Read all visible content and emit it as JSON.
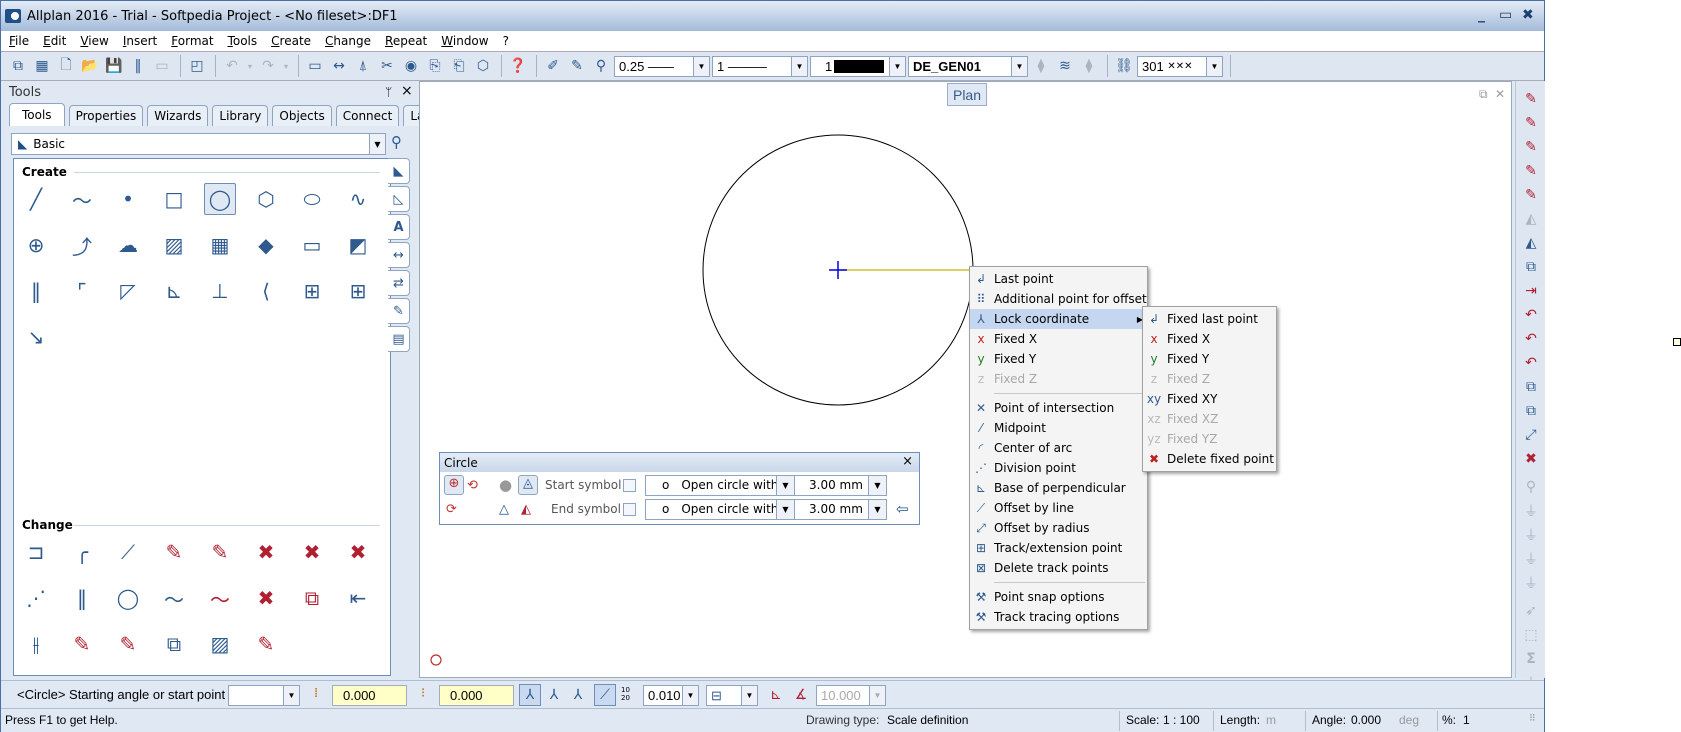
{
  "window": {
    "title": "Allplan 2016 - Trial - Softpedia Project - <No fileset>:DF1",
    "controls": {
      "minimize": "_",
      "maximize": "▭",
      "close": "✖"
    }
  },
  "menubar": [
    "File",
    "Edit",
    "View",
    "Insert",
    "Format",
    "Tools",
    "Create",
    "Change",
    "Repeat",
    "Window",
    "?"
  ],
  "toolbar": {
    "pen_thickness": "0.25 ——",
    "line_type": "1 ———",
    "color": "1",
    "color_swatch": "#000000",
    "layer": "DE_GEN01",
    "pattern_value": "301",
    "pattern_glyph": "✕✕✕"
  },
  "tools_panel": {
    "title": "Tools",
    "pin": "📌",
    "close": "×",
    "tabs": [
      "Tools",
      "Properties",
      "Wizards",
      "Library",
      "Objects",
      "Connect",
      "Layers"
    ],
    "active_tab": "Tools",
    "family": "Basic",
    "sections": {
      "create": "Create",
      "change": "Change"
    },
    "create_icons": [
      "line-icon",
      "polyline-icon",
      "point-icon",
      "rectangle-icon",
      "circle-icon",
      "polygon-icon",
      "ellipse-icon",
      "spline-icon",
      "cross-circle-icon",
      "offset-icon",
      "cloud-icon",
      "hatching-icon",
      "pattern-icon",
      "fill-icon",
      "bitmap-icon",
      "style-area-icon",
      "parallel-lines-icon",
      "parallel-offset-icon",
      "surface-icon",
      "angle-icon",
      "perpendicular-icon",
      "tangent-icon",
      "grid-copy-icon",
      "matrix-copy-icon",
      "point-to-line-icon"
    ],
    "change_icons": [
      "join-lines-icon",
      "fillet-icon",
      "chamfer-icon",
      "modify-lines-icon",
      "modify-area-icon",
      "delete-segment-icon",
      "delete-between-icon",
      "delete-point-icon",
      "divide-icon",
      "parallel-edit-icon",
      "parallel-circle-icon",
      "polyline-edit-icon",
      "polyline-delete-icon",
      "split-icon",
      "delete-overlap-icon",
      "align-icon",
      "mid-align-icon",
      "edit-copy-icon",
      "edit-transform-icon",
      "group-icon",
      "hatch-edit-icon",
      "pattern-edit-icon"
    ]
  },
  "view": {
    "label": "Plan"
  },
  "context_menu": {
    "items": [
      {
        "label": "Last point",
        "icon": "↲",
        "disabled": false
      },
      {
        "label": "Additional point for offset",
        "icon": "⠿",
        "disabled": false
      },
      {
        "label": "Lock coordinate",
        "icon": "⅄",
        "disabled": false,
        "highlighted": true,
        "submenu": true
      },
      {
        "label": "Fixed X",
        "icon": "x",
        "disabled": false
      },
      {
        "label": "Fixed Y",
        "icon": "y",
        "disabled": false
      },
      {
        "label": "Fixed Z",
        "icon": "z",
        "disabled": true
      },
      {
        "separator": true
      },
      {
        "label": "Point of intersection",
        "icon": "✕",
        "disabled": false
      },
      {
        "label": "Midpoint",
        "icon": "⁄",
        "disabled": false
      },
      {
        "label": "Center of arc",
        "icon": "◜",
        "disabled": false
      },
      {
        "label": "Division point",
        "icon": "⋰",
        "disabled": false
      },
      {
        "label": "Base of perpendicular",
        "icon": "⊾",
        "disabled": false
      },
      {
        "label": "Offset by line",
        "icon": "⟋",
        "disabled": false
      },
      {
        "label": "Offset by radius",
        "icon": "⤢",
        "disabled": false
      },
      {
        "label": "Track/extension point",
        "icon": "⊞",
        "disabled": false
      },
      {
        "label": "Delete track points",
        "icon": "⊠",
        "disabled": false
      },
      {
        "separator": true
      },
      {
        "label": "Point snap options",
        "icon": "⚒",
        "disabled": false
      },
      {
        "label": "Track tracing options",
        "icon": "⚒",
        "disabled": false
      }
    ]
  },
  "submenu": {
    "items": [
      {
        "label": "Fixed last point",
        "icon": "↲",
        "disabled": false
      },
      {
        "label": "Fixed X",
        "icon": "x",
        "disabled": false
      },
      {
        "label": "Fixed Y",
        "icon": "y",
        "disabled": false
      },
      {
        "label": "Fixed Z",
        "icon": "z",
        "disabled": true
      },
      {
        "label": "Fixed XY",
        "icon": "xy",
        "disabled": false
      },
      {
        "label": "Fixed XZ",
        "icon": "xz",
        "disabled": true
      },
      {
        "label": "Fixed YZ",
        "icon": "yz",
        "disabled": true
      },
      {
        "label": "Delete fixed point",
        "icon": "✖",
        "disabled": false
      }
    ]
  },
  "circle_dialog": {
    "title": "Circle",
    "close": "×",
    "start_symbol_label": "Start symbol",
    "end_symbol_label": "End symbol",
    "start_symbol_type": "Open circle with",
    "end_symbol_type": "Open circle with",
    "start_size": "3.00 mm",
    "end_size": "3.00 mm",
    "symbol_glyph": "o",
    "apply_arrow": "⇦"
  },
  "input_bar": {
    "prompt": "<Circle> Starting angle or start point",
    "dropdown_value": "",
    "x_value": "0.000",
    "y_value": "0.000",
    "grid_label": "10 20",
    "step_value": "0.010",
    "angle_value": "10.000"
  },
  "status_bar": {
    "help": "Press F1 to get Help.",
    "drawing_type_label": "Drawing type:",
    "drawing_type_value": "Scale definition",
    "scale_label": "Scale:",
    "scale_value": "1 : 100",
    "length_label": "Length:",
    "length_unit": "m",
    "angle_label": "Angle:",
    "angle_value": "0.000",
    "angle_unit": "deg",
    "percent_label": "%:",
    "percent_value": "1"
  }
}
